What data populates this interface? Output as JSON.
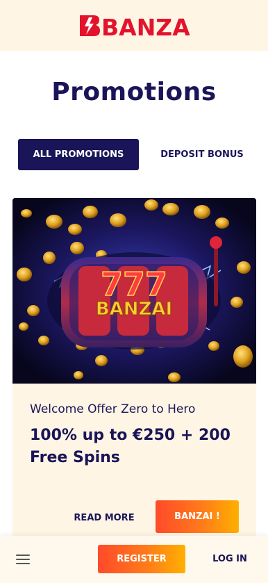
{
  "header": {
    "logo_text": "BANZAI",
    "brand_color": "#e3132c"
  },
  "page": {
    "title": "Promotions"
  },
  "tabs": [
    {
      "label": "ALL PROMOTIONS",
      "active": true
    },
    {
      "label": "DEPOSIT BONUS",
      "active": false
    }
  ],
  "promo": {
    "image_text": "BANZAI",
    "image_numbers": "777",
    "subtitle": "Welcome Offer Zero to Hero",
    "title": "100% up to €250 + 200 Free Spins",
    "read_more_label": "READ MORE",
    "cta_label": "BANZAI !"
  },
  "bottom_bar": {
    "menu_icon": "hamburger-menu-icon",
    "register_label": "REGISTER",
    "login_label": "LOG IN"
  },
  "colors": {
    "navy": "#1a1458",
    "cream": "#fff5e4",
    "cta_gradient_start": "#ff4a2a",
    "cta_gradient_end": "#ffb000"
  }
}
